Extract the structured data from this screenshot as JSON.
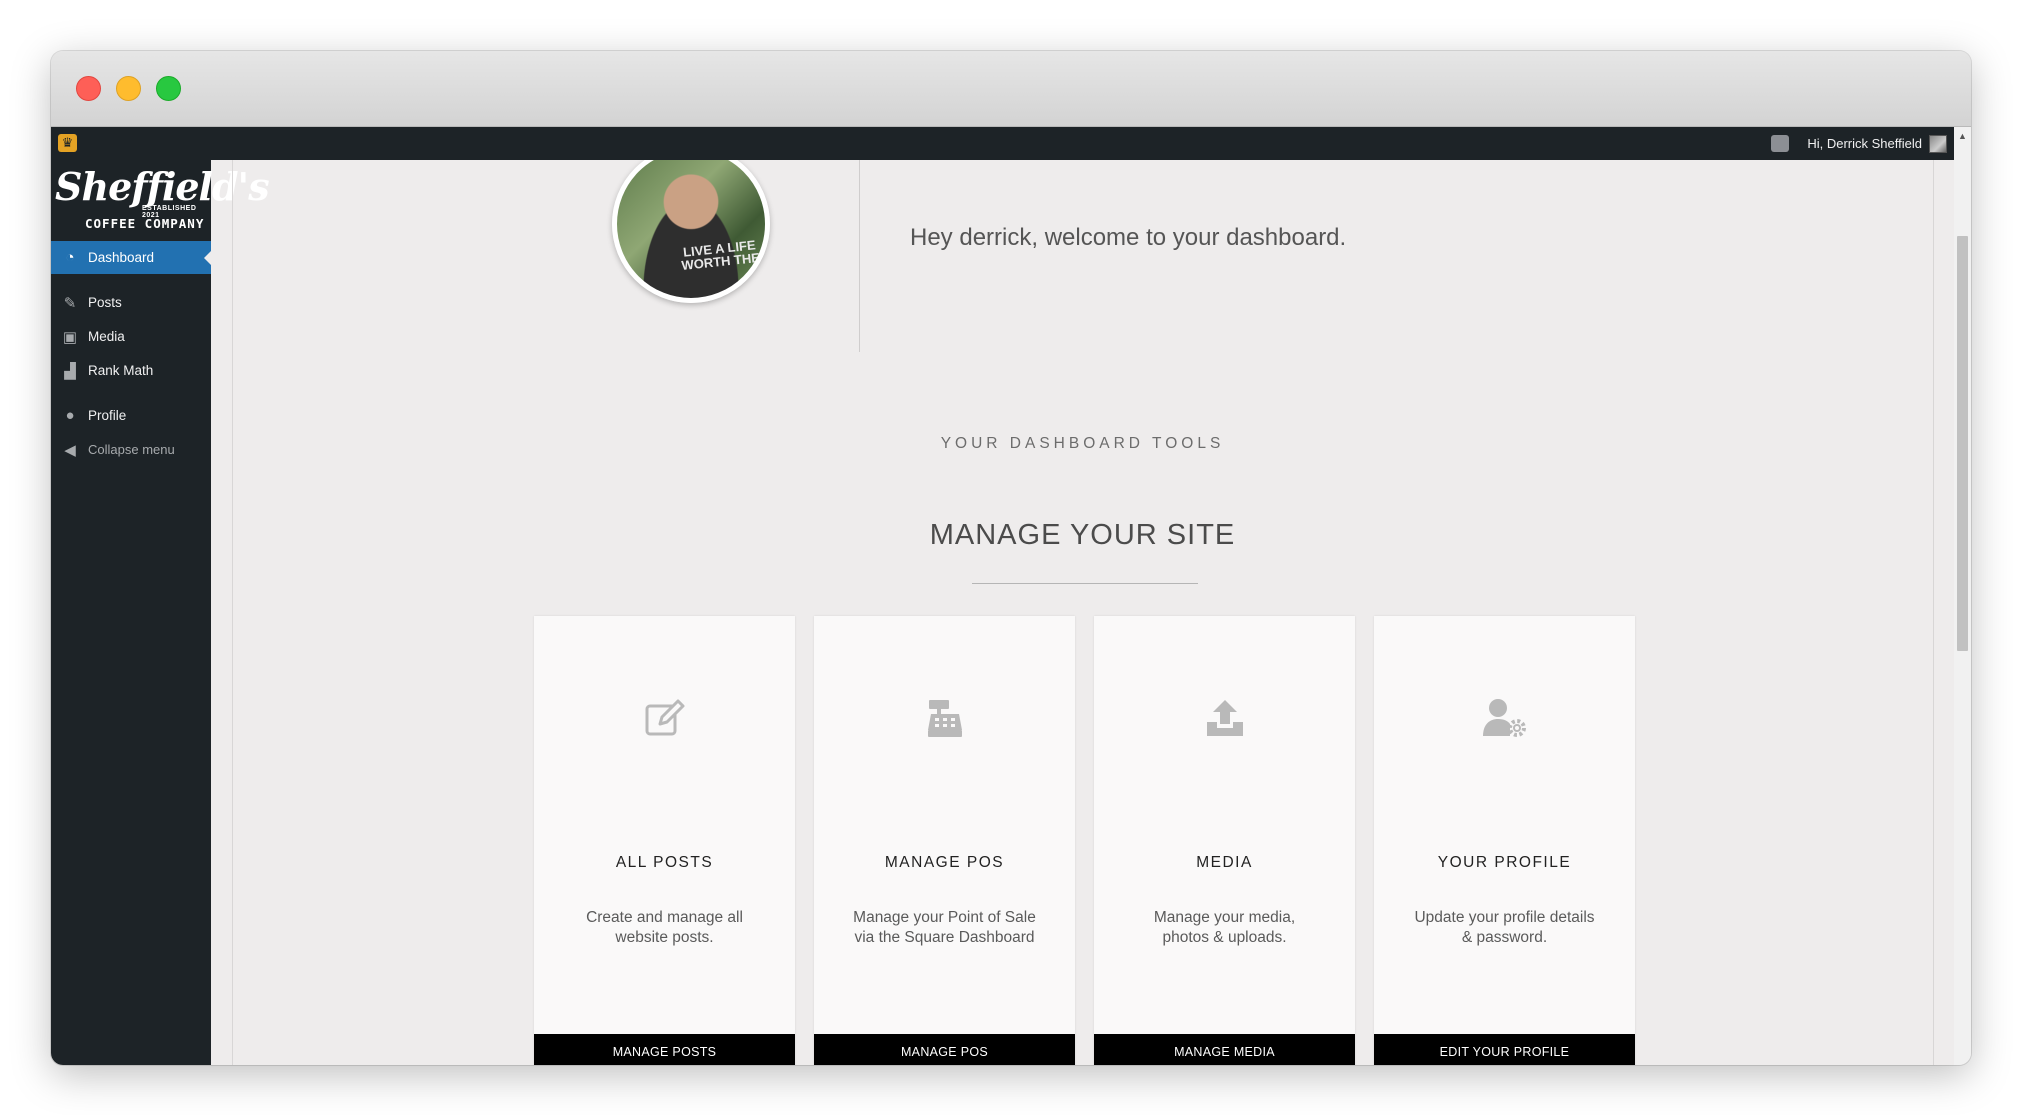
{
  "window": {
    "controls": [
      "close",
      "minimize",
      "maximize"
    ]
  },
  "adminbar": {
    "logo_icon": "crown-icon",
    "comments_icon": "comment-icon",
    "greeting": "Hi, Derrick Sheffield"
  },
  "sidebar": {
    "logo": {
      "script": "Sheffield's",
      "established": "ESTABLISHED 2021",
      "company": "COFFEE COMPANY"
    },
    "items": [
      {
        "label": "Dashboard",
        "icon": "dashboard-icon",
        "active": true
      },
      {
        "label": "Posts",
        "icon": "pin-icon"
      },
      {
        "label": "Media",
        "icon": "media-icon"
      },
      {
        "label": "Rank Math",
        "icon": "chart-icon"
      },
      {
        "label": "Profile",
        "icon": "user-icon"
      },
      {
        "label": "Collapse menu",
        "icon": "collapse-icon"
      }
    ]
  },
  "main": {
    "photo_shirt_text": "LIVE A LIFE WORTH THE",
    "welcome": "Hey derrick, welcome to your dashboard.",
    "tools_label": "YOUR DASHBOARD TOOLS",
    "section_title": "MANAGE YOUR SITE",
    "cards": [
      {
        "icon": "edit-icon",
        "title": "ALL POSTS",
        "description": "Create and manage all website posts.",
        "button": "MANAGE POSTS"
      },
      {
        "icon": "cash-register-icon",
        "title": "MANAGE POS",
        "description": "Manage your Point of Sale via the Square Dashboard",
        "button": "MANAGE POS"
      },
      {
        "icon": "upload-icon",
        "title": "MEDIA",
        "description": "Manage your media, photos & uploads.",
        "button": "MANAGE MEDIA"
      },
      {
        "icon": "user-cog-icon",
        "title": "YOUR PROFILE",
        "description": "Update your profile details & password.",
        "button": "EDIT YOUR PROFILE"
      }
    ]
  }
}
